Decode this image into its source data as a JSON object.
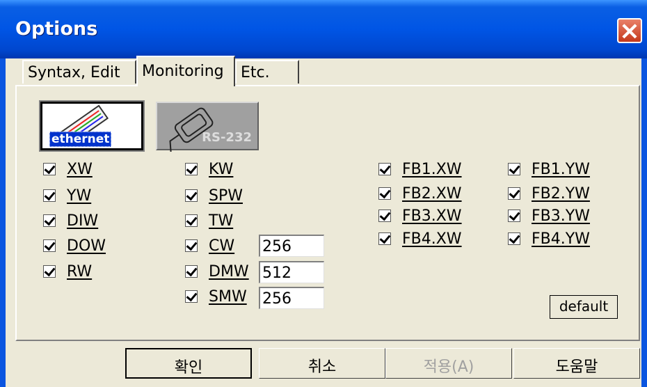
{
  "window": {
    "title": "Options"
  },
  "tabs": [
    {
      "label": "Syntax, Edit"
    },
    {
      "label": "Monitoring"
    },
    {
      "label": "Etc."
    }
  ],
  "connections": {
    "ethernet_label": "ethernet",
    "rs232_label": "RS-232"
  },
  "checkboxes": {
    "col1": [
      "XW",
      "YW",
      "DIW",
      "DOW",
      "RW"
    ],
    "col2": [
      "KW",
      "SPW",
      "TW",
      "CW",
      "DMW",
      "SMW"
    ],
    "col3": [
      "FB1.XW",
      "FB2.XW",
      "FB3.XW",
      "FB4.XW"
    ],
    "col4": [
      "FB1.YW",
      "FB2.YW",
      "FB3.YW",
      "FB4.YW"
    ]
  },
  "fields": {
    "cw": "256",
    "dmw": "512",
    "smw": "256"
  },
  "default_label": "default",
  "buttons": {
    "ok": "확인",
    "cancel": "취소",
    "apply": "적용(A)",
    "help": "도움말"
  }
}
